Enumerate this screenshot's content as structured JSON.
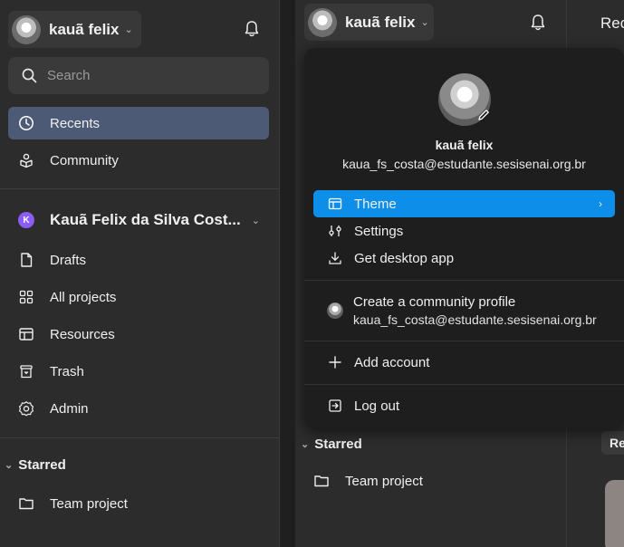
{
  "left": {
    "user_name": "kauã felix",
    "search_placeholder": "Search",
    "nav": {
      "recents": "Recents",
      "community": "Community"
    },
    "team_initial": "K",
    "team_name": "Kauã Felix da Silva Cost...",
    "team_nav": {
      "drafts": "Drafts",
      "all_projects": "All projects",
      "resources": "Resources",
      "trash": "Trash",
      "admin": "Admin"
    },
    "starred_label": "Starred",
    "starred_item": "Team project"
  },
  "right": {
    "user_name": "kauã felix",
    "tab_partial": "Rec",
    "re_partial": "Re",
    "menu": {
      "name": "kauã felix",
      "email": "kaua_fs_costa@estudante.sesisenai.org.br",
      "theme": "Theme",
      "settings": "Settings",
      "desktop": "Get desktop app",
      "community_title": "Create a community profile",
      "community_email": "kaua_fs_costa@estudante.sesisenai.org.br",
      "add_account": "Add account",
      "log_out": "Log out"
    },
    "starred_label": "Starred",
    "starred_item": "Team project"
  },
  "colors": {
    "active_nav": "#4c5a76",
    "menu_highlight": "#0d8ee9",
    "team_badge": "#8b5cf6"
  }
}
